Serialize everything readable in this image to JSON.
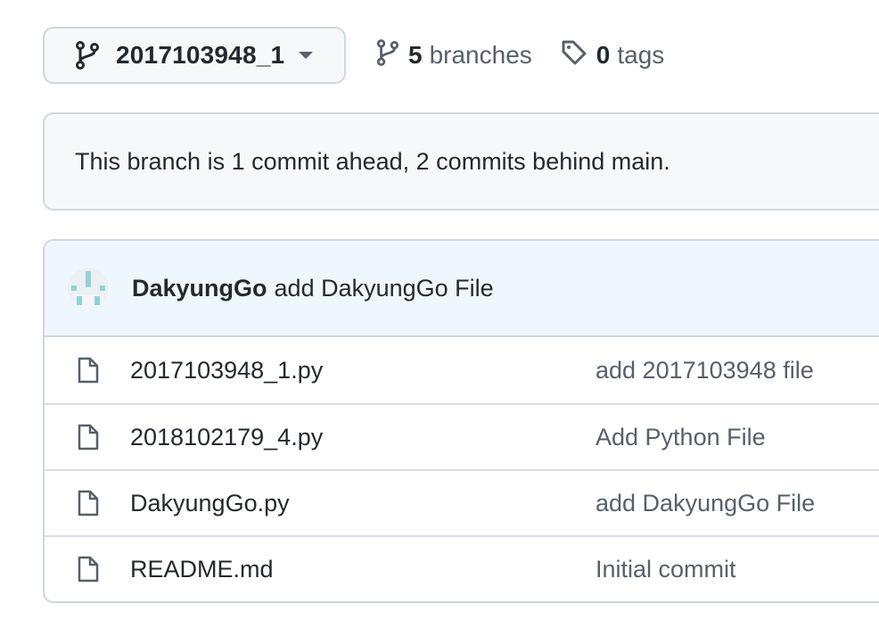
{
  "branch_selector": {
    "current_branch": "2017103948_1",
    "branch_icon": "git-branch-icon",
    "caret_icon": "caret-down-icon"
  },
  "branches_link": {
    "count": "5",
    "label": "branches",
    "icon": "git-branch-icon"
  },
  "tags_link": {
    "count": "0",
    "label": "tags",
    "icon": "tag-icon"
  },
  "notice": {
    "text": "This branch is 1 commit ahead, 2 commits behind main."
  },
  "latest_commit": {
    "author": "DakyungGo",
    "message": "add DakyungGo File"
  },
  "files": [
    {
      "name": "2017103948_1.py",
      "commit_message": "add 2017103948 file",
      "icon": "file-icon"
    },
    {
      "name": "2018102179_4.py",
      "commit_message": "Add Python File",
      "icon": "file-icon"
    },
    {
      "name": "DakyungGo.py",
      "commit_message": "add DakyungGo File",
      "icon": "file-icon"
    },
    {
      "name": "README.md",
      "commit_message": "Initial commit",
      "icon": "file-icon"
    }
  ],
  "colors": {
    "border": "#d0d7de",
    "muted_text": "#57606a",
    "primary_text": "#24292f",
    "commit_header_bg": "#eef7fe",
    "notice_bg": "#f6f8fa"
  }
}
